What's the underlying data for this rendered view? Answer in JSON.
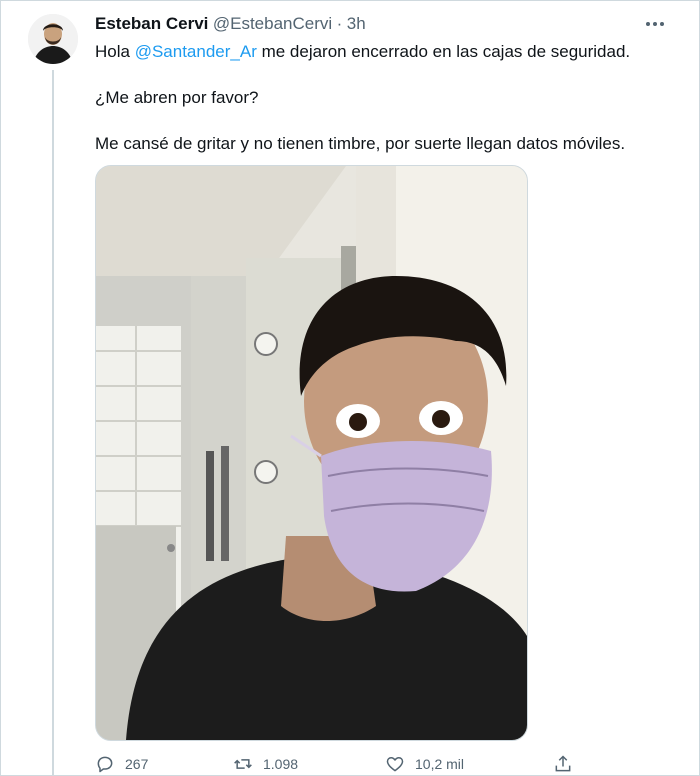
{
  "tweet": {
    "author_name": "Esteban Cervi",
    "author_handle": "@EstebanCervi",
    "separator": "·",
    "time": "3h",
    "text_prefix": "Hola ",
    "mention": "@Santander_Ar",
    "text_suffix": " me dejaron encerrado en las cajas de seguridad.",
    "paragraph_2": "¿Me abren por favor?",
    "paragraph_3": "Me cansé de gritar y no tienen timbre, por suerte llegan datos móviles."
  },
  "actions": {
    "replies": "267",
    "retweets": "1.098",
    "likes": "10,2 mil"
  },
  "icons": {
    "more": "more-icon",
    "reply": "reply-icon",
    "retweet": "retweet-icon",
    "like": "heart-icon",
    "share": "share-icon"
  },
  "colors": {
    "accent": "#1d9bf0",
    "text": "#0f1419",
    "secondary": "#536471",
    "border": "#cfd9de"
  }
}
